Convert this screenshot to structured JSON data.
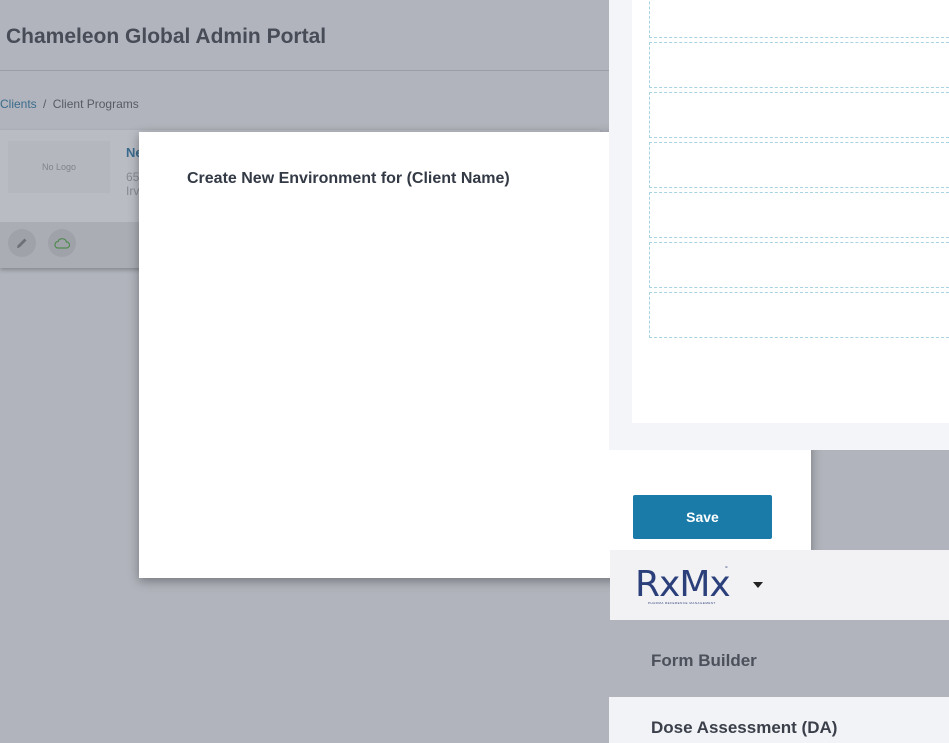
{
  "app": {
    "title": "Chameleon Global Admin Portal"
  },
  "breadcrumb": {
    "clients": "Clients",
    "separator": "/",
    "current": "Client Programs"
  },
  "client_card": {
    "logo_placeholder": "No Logo",
    "name": "Ne",
    "address_line1": "65",
    "address_line2": "Irv",
    "edit_icon": "pencil-icon",
    "cloud_icon": "cloud-icon"
  },
  "modal": {
    "title": "Create New Environment for (Client Name)",
    "save_label": "Save"
  },
  "nav": {
    "brand": "RxMx",
    "brand_tagline": "PHARMA REFERENCE MANAGEMENT",
    "brand_mark": "°",
    "items": [
      "Form Builder",
      "Dose Assessment (DA)"
    ]
  },
  "colors": {
    "primary": "#1b7ba8",
    "link": "#3b6b8c",
    "overlay": "#b1b4bc",
    "slot_border": "#a7d3e2"
  }
}
